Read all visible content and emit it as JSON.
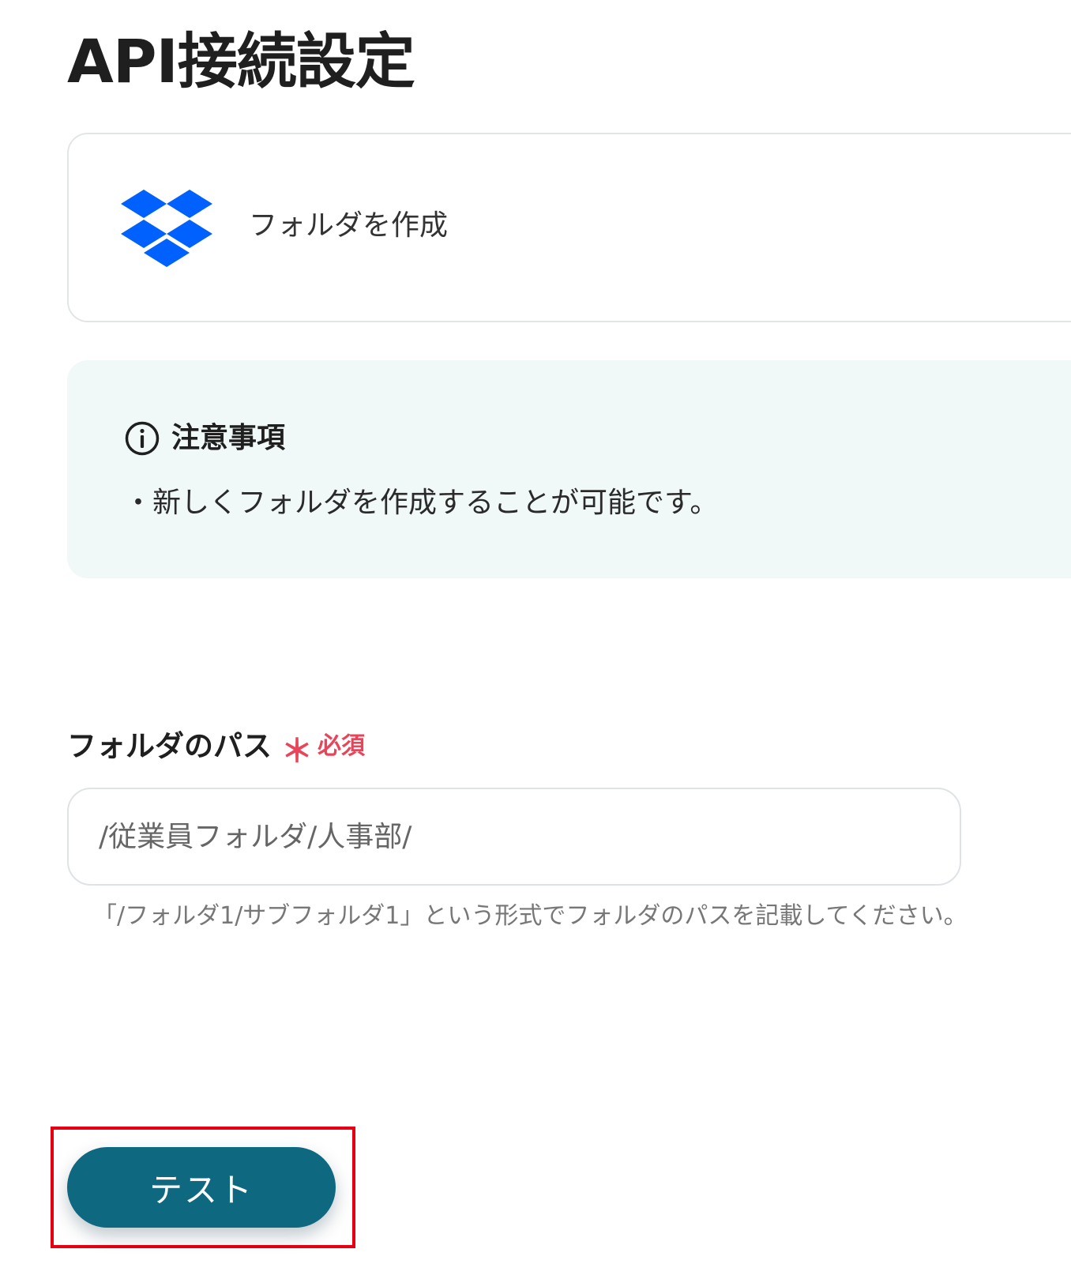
{
  "page": {
    "title": "API接続設定"
  },
  "action": {
    "app_icon": "dropbox-icon",
    "label": "フォルダを作成"
  },
  "notice": {
    "icon": "info-icon",
    "title": "注意事項",
    "body": "・新しくフォルダを作成することが可能です。"
  },
  "form": {
    "folder_path": {
      "label": "フォルダのパス",
      "required_mark": "＊",
      "required_label": "必須",
      "placeholder": "/従業員フォルダ/人事部/",
      "hint": "「/フォルダ1/サブフォルダ1」という形式でフォルダのパスを記載してください。"
    }
  },
  "buttons": {
    "test_label": "テスト"
  },
  "colors": {
    "dropbox_blue": "#0061fe",
    "notice_bg": "#f0f8f8",
    "required_red": "#e8445a",
    "button_teal": "#0e6880",
    "highlight_red": "#e60012"
  }
}
